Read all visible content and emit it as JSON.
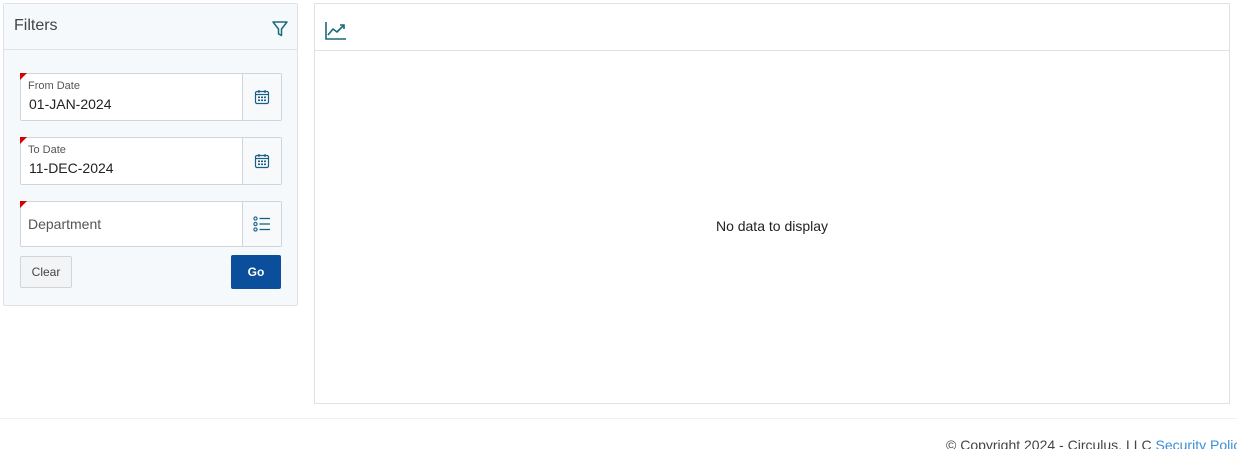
{
  "filters": {
    "title": "Filters",
    "from_date": {
      "label": "From Date",
      "value": "01-JAN-2024"
    },
    "to_date": {
      "label": "To Date",
      "value": "11-DEC-2024"
    },
    "department": {
      "placeholder": "Department"
    },
    "clear_label": "Clear",
    "go_label": "Go"
  },
  "chart": {
    "empty_message": "No data to display"
  },
  "footer": {
    "copyright": "© Copyright 2024 - Circulus, LLC ",
    "link": "Security Policy"
  },
  "colors": {
    "primary": "#0b4f9c",
    "required_marker": "#d40000",
    "icon": "#1a6a7a",
    "link": "#3a8fd8"
  },
  "icons": {
    "filter": "funnel-icon",
    "calendar": "calendar-icon",
    "list": "list-icon",
    "chart": "line-chart-icon"
  }
}
